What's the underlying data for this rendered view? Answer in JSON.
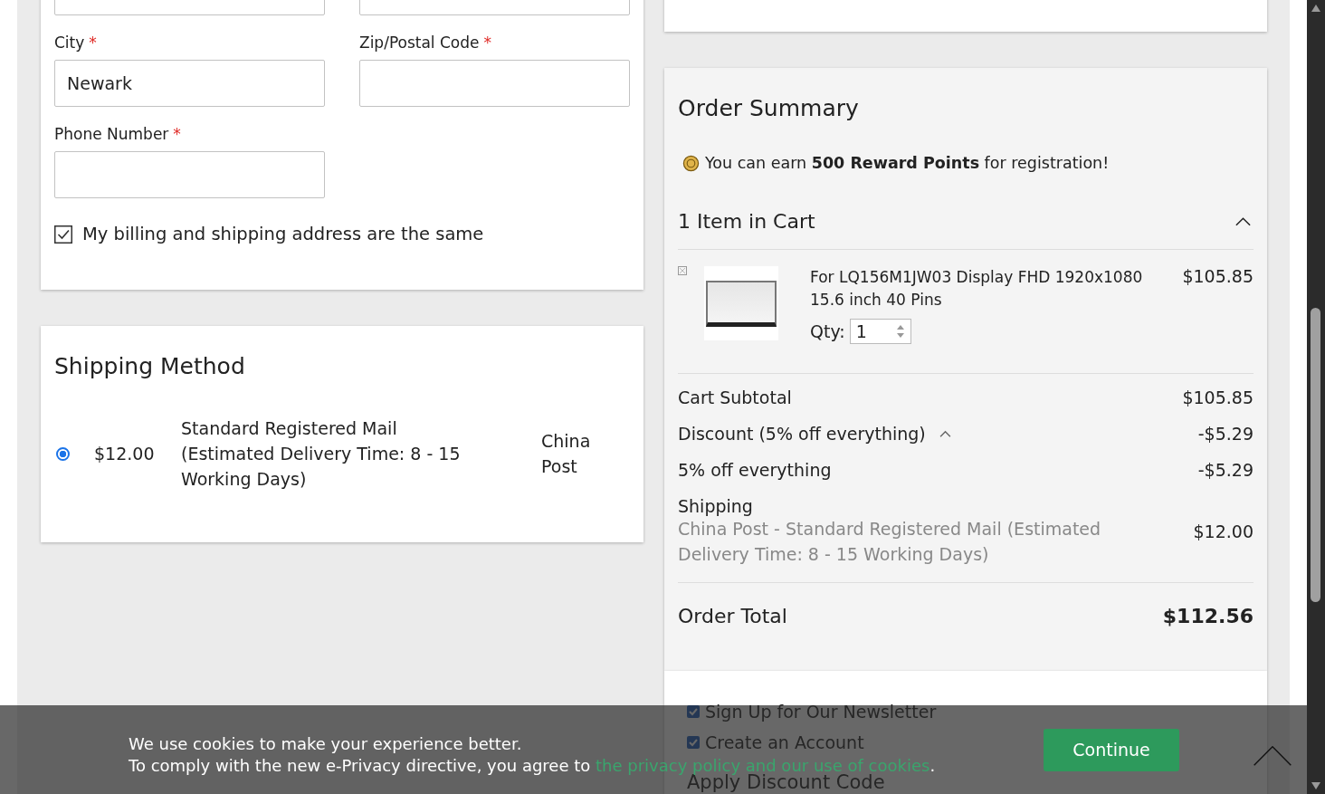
{
  "billing": {
    "fields": [
      {
        "label": "City",
        "required": true,
        "required_mark": "*",
        "value": "Newark"
      },
      {
        "label": "Zip/Postal Code",
        "required": true,
        "required_mark": "*"
      },
      {
        "label": "Phone Number",
        "required": true,
        "required_mark": "*"
      }
    ],
    "same_address": {
      "label": "My billing and shipping address are the same",
      "checked": true
    }
  },
  "shipping_method": {
    "title": "Shipping Method",
    "options": [
      {
        "selected": true,
        "price": "$12.00",
        "method": "Standard Registered Mail (Estimated Delivery Time: 8 - 15 Working Days)",
        "carrier": "China Post"
      }
    ]
  },
  "order_summary": {
    "title": "Order Summary",
    "reward": "You can earn **500 Reward Points** for registration!",
    "cart_header": "1 Item in Cart",
    "expanded": true,
    "items": [
      {
        "name": "For LQ156M1JW03 Display FHD 1920x1080 15.6 inch 40 Pins",
        "price": "$105.85",
        "qty_label": "Qty:",
        "qty": "1"
      }
    ],
    "totals": [
      {
        "kind": "line",
        "label": "Cart Subtotal",
        "value": "$105.85"
      },
      {
        "kind": "discount",
        "label": "Discount (5% off everything)",
        "value": "-$5.29",
        "expanded": true
      },
      {
        "kind": "line",
        "label": "5% off everything",
        "value": "-$5.29"
      },
      {
        "kind": "shipping",
        "label": "Shipping",
        "detail": "China Post - Standard Registered Mail (Estimated Delivery Time: 8 - 15 Working Days)",
        "value": "$12.00"
      }
    ],
    "order_total": {
      "label": "Order Total",
      "value": "$112.56"
    }
  },
  "options": [
    {
      "label": "Sign Up for Our Newsletter",
      "checked": true
    },
    {
      "label": "Create an Account",
      "checked": true
    }
  ],
  "discount_heading": "Apply Discount Code",
  "cookie_bar": {
    "line1": "We use cookies to make your experience better.",
    "line2": "To comply with the new e-Privacy directive, you agree to",
    "link": "the privacy policy and our use of cookies",
    "suffix": ".",
    "button": "Continue"
  }
}
